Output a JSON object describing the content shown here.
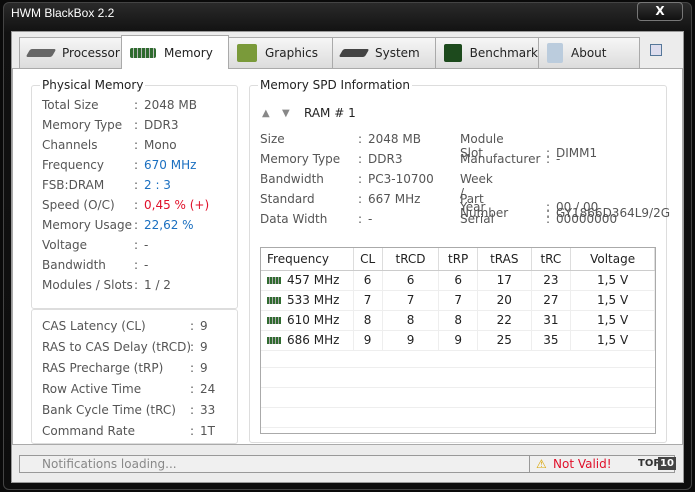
{
  "window": {
    "title": "HWM BlackBox 2.2",
    "close": "X"
  },
  "tabs": [
    {
      "label": "Processor"
    },
    {
      "label": "Memory"
    },
    {
      "label": "Graphics"
    },
    {
      "label": "System"
    },
    {
      "label": "Benchmark"
    },
    {
      "label": "About"
    }
  ],
  "physical": {
    "title": "Physical Memory",
    "rows": [
      {
        "label": "Total Size",
        "value": "2048 MB"
      },
      {
        "label": "Memory Type",
        "value": "DDR3"
      },
      {
        "label": "Channels",
        "value": "Mono"
      },
      {
        "label": "Frequency",
        "value": "670 MHz"
      },
      {
        "label": "FSB:DRAM",
        "value": "2 : 3"
      },
      {
        "label": "Speed (O/C)",
        "value": "0,45 % (+)"
      },
      {
        "label": "Memory Usage",
        "value": "22,62 %"
      },
      {
        "label": "Voltage",
        "value": "-"
      },
      {
        "label": "Bandwidth",
        "value": "-"
      },
      {
        "label": "Modules / Slots",
        "value": "1  /  2"
      }
    ]
  },
  "timings": {
    "rows": [
      {
        "label": "CAS Latency (CL)",
        "value": "9"
      },
      {
        "label": "RAS to CAS Delay (tRCD)",
        "value": "9"
      },
      {
        "label": "RAS Precharge (tRP)",
        "value": "9"
      },
      {
        "label": "Row Active Time",
        "value": "24"
      },
      {
        "label": "Bank Cycle Time (tRC)",
        "value": "33"
      },
      {
        "label": "Command Rate",
        "value": "1T"
      }
    ]
  },
  "spd": {
    "title": "Memory SPD Information",
    "ram": "RAM # 1",
    "left": [
      {
        "label": "Size",
        "value": "2048 MB"
      },
      {
        "label": "Memory Type",
        "value": "DDR3"
      },
      {
        "label": "Bandwidth",
        "value": "PC3-10700"
      },
      {
        "label": "Standard",
        "value": "667 MHz"
      },
      {
        "label": "Data Width",
        "value": "-"
      }
    ],
    "right": [
      {
        "label": "Module Slot",
        "value": "DIMM1"
      },
      {
        "label": "Manufacturer",
        "value": "-"
      },
      {
        "label": "Week / Year",
        "value": "00 / 00"
      },
      {
        "label": "Part Number",
        "value": "GY1866D364L9/2G"
      },
      {
        "label": "Serial",
        "value": "00000000"
      }
    ],
    "table": {
      "headers": [
        "Frequency",
        "CL",
        "tRCD",
        "tRP",
        "tRAS",
        "tRC",
        "Voltage"
      ],
      "rows": [
        [
          "457 MHz",
          "6",
          "6",
          "6",
          "17",
          "23",
          "1,5 V"
        ],
        [
          "533 MHz",
          "7",
          "7",
          "7",
          "20",
          "27",
          "1,5 V"
        ],
        [
          "610 MHz",
          "8",
          "8",
          "8",
          "22",
          "31",
          "1,5 V"
        ],
        [
          "686 MHz",
          "9",
          "9",
          "9",
          "25",
          "35",
          "1,5 V"
        ]
      ]
    }
  },
  "status": {
    "notification": "Notifications loading...",
    "validity": "Not Valid!",
    "top": "TOP",
    "ten": "10"
  }
}
